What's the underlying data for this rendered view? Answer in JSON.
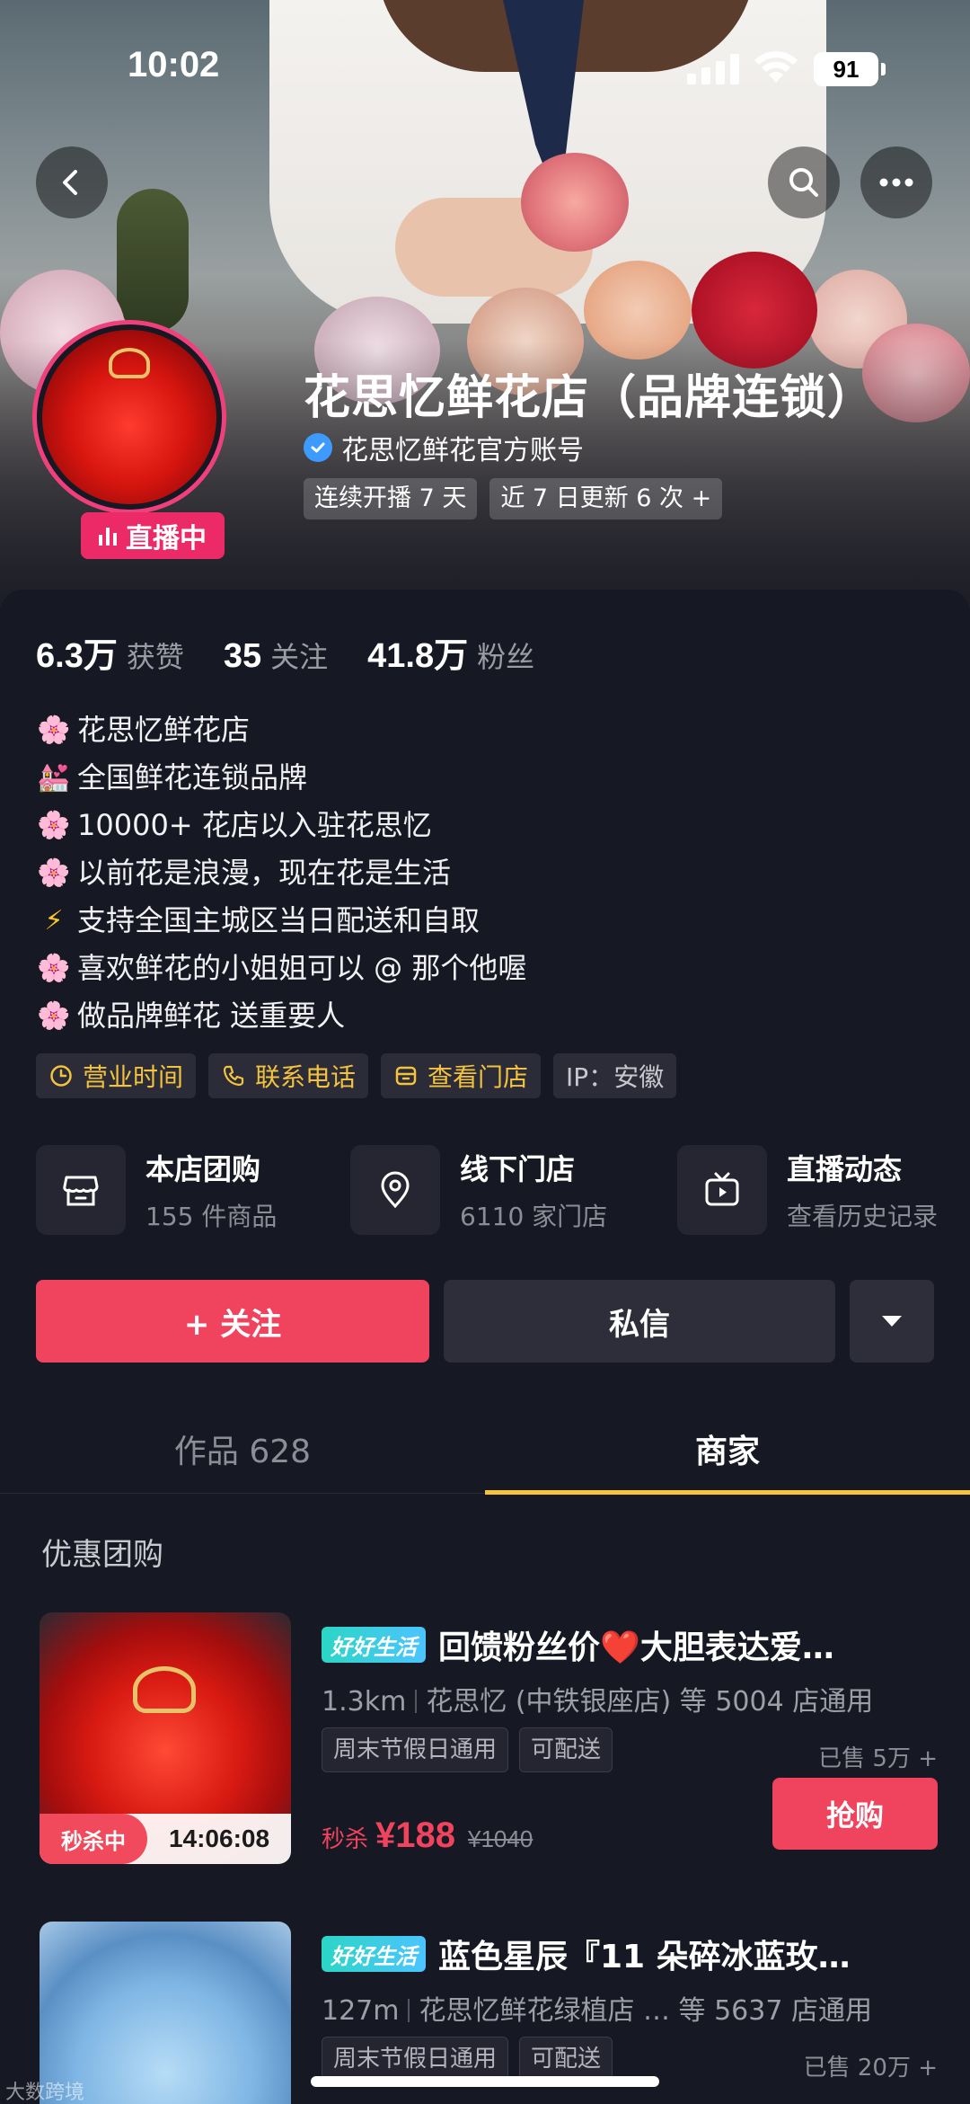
{
  "status_bar": {
    "time": "10:02",
    "battery": "91"
  },
  "shop": {
    "name": "花思忆鲜花店（品牌连锁）",
    "verified_label": "花思忆鲜花官方账号",
    "tags": [
      "连续开播 7 天",
      "近 7 日更新 6 次 +"
    ],
    "live_badge": "直播中"
  },
  "stats": [
    {
      "value": "6.3万",
      "label": "获赞"
    },
    {
      "value": "35",
      "label": "关注"
    },
    {
      "value": "41.8万",
      "label": "粉丝"
    }
  ],
  "bio": [
    {
      "icon": "🌸",
      "icon_name": "blossom-icon",
      "text": "花思忆鲜花店"
    },
    {
      "icon": "💒",
      "icon_name": "wedding-icon",
      "text": "全国鲜花连锁品牌"
    },
    {
      "icon": "🌸",
      "icon_name": "blossom-icon",
      "text": "10000+ 花店以入驻花思忆"
    },
    {
      "icon": "🌸",
      "icon_name": "blossom-icon",
      "text": "以前花是浪漫，现在花是生活"
    },
    {
      "icon": "⚡",
      "icon_name": "lightning-icon",
      "text": "支持全国主城区当日配送和自取"
    },
    {
      "icon": "🌸",
      "icon_name": "blossom-icon",
      "text": "喜欢鲜花的小姐姐可以 @ 那个他喔"
    },
    {
      "icon": "🌸",
      "icon_name": "blossom-icon",
      "text": "做品牌鲜花 送重要人"
    }
  ],
  "quick_tags": {
    "hours": "营业时间",
    "phone": "联系电话",
    "stores": "查看门店",
    "ip": "IP：安徽"
  },
  "features": {
    "group_buy": {
      "title": "本店团购",
      "subtitle": "155 件商品"
    },
    "offline_store": {
      "title": "线下门店",
      "subtitle": "6110 家门店"
    },
    "live_feed": {
      "title": "直播动态",
      "subtitle": "查看历史记录"
    }
  },
  "actions": {
    "follow": "+ 关注",
    "message": "私信"
  },
  "tabs": {
    "works": "作品 628",
    "merchant": "商家"
  },
  "section_title": "优惠团购",
  "products": [
    {
      "brand_tag": "好好生活",
      "title": "回馈粉丝价",
      "title_emoji": "❤️",
      "title_rest": "大胆表达爱…",
      "distance": "1.3km",
      "store": "花思忆 (中铁银座店) 等 5004 店通用",
      "tags": [
        "周末节假日通用",
        "可配送"
      ],
      "sold": "已售 5万 +",
      "price_prefix": "秒杀",
      "price": "¥188",
      "orig_price": "¥1040",
      "buy_label": "抢购",
      "flash_label": "秒杀中",
      "flash_time": "14:06:08"
    },
    {
      "brand_tag": "好好生活",
      "title": "蓝色星辰『11 朵碎冰蓝玫…",
      "distance": "127m",
      "store": "花思忆鲜花绿植店 …   等 5637 店通用",
      "tags": [
        "周末节假日通用",
        "可配送"
      ],
      "sold": "已售 20万 +"
    }
  ],
  "watermark": "大数跨境",
  "colors": {
    "accent": "#f0445e",
    "live": "#ec2a67",
    "tab_underline": "#f5c43a",
    "quick_tag_text": "#f3c23e",
    "background": "#161823"
  }
}
